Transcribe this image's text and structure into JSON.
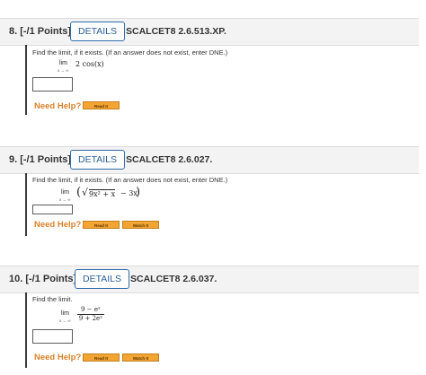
{
  "questions": [
    {
      "number": "8. [-/1 Points]",
      "details_label": "DETAILS",
      "code": "SCALCET8 2.6.513.XP.",
      "prompt": "Find the limit, if it exists. (If an answer does not exist, enter DNE.)",
      "lim": "lim",
      "lim_sub": "x → ∞",
      "expression": "2 cos(x)",
      "need_help": "Need Help?",
      "buttons": [
        "Read It"
      ]
    },
    {
      "number": "9. [-/1 Points]",
      "details_label": "DETAILS",
      "code": "SCALCET8 2.6.027.",
      "prompt": "Find the limit, if it exists. (If an answer does not exist, enter DNE.)",
      "lim": "lim",
      "lim_sub": "x → ∞",
      "sqrt_body": "9x² + x",
      "tail": "− 3x",
      "need_help": "Need Help?",
      "buttons": [
        "Read It",
        "Watch It"
      ]
    },
    {
      "number": "10. [-/1 Points]",
      "details_label": "DETAILS",
      "code": "SCALCET8 2.6.037.",
      "prompt": "Find the limit.",
      "lim": "lim",
      "lim_sub": "x → ∞",
      "numerator": "9 − eˣ",
      "denominator": "9 + 2eˣ",
      "need_help": "Need Help?",
      "buttons": [
        "Read It",
        "Watch It"
      ]
    }
  ],
  "colors": {
    "accent": "#2f6aa8",
    "help": "#d9822b",
    "button": "#f3a533"
  }
}
